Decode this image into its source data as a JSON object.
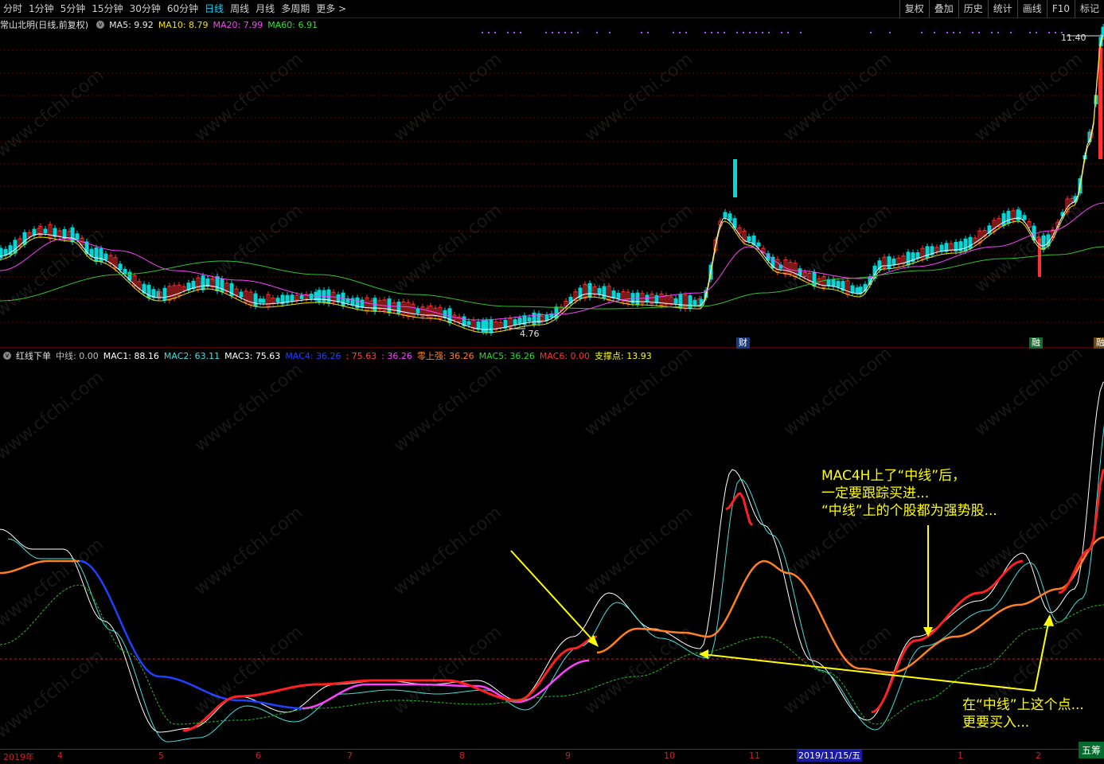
{
  "toolbar": {
    "tabs": [
      "分时",
      "1分钟",
      "5分钟",
      "15分钟",
      "30分钟",
      "60分钟",
      "日线",
      "周线",
      "月线",
      "多周期",
      "更多 >"
    ],
    "active_tab": "日线",
    "right": [
      "复权",
      "叠加",
      "历史",
      "统计",
      "画线",
      "F10",
      "标记"
    ]
  },
  "main_legend": {
    "title": "常山北明(日线,前复权)",
    "ma5": "MA5: 9.92",
    "ma10": "MA10: 8.79",
    "ma20": "MA20: 7.99",
    "ma60": "MA60: 6.91"
  },
  "indicator_legend": {
    "name": "红线下单",
    "items": [
      {
        "text": "中线: 0.00",
        "color": "#bfbfbf"
      },
      {
        "text": "MAC1: 88.16",
        "color": "#ffffff"
      },
      {
        "text": "MAC2: 63.11",
        "color": "#40e0e0"
      },
      {
        "text": "MAC3: 75.63",
        "color": "#ffffff"
      },
      {
        "text": "MAC4: 36.26",
        "color": "#2040ff"
      },
      {
        "text": ": 75.63",
        "color": "#ff4040"
      },
      {
        "text": ": 36.26",
        "color": "#ff40ff"
      },
      {
        "text": "零上强: 36.26",
        "color": "#ff8020"
      },
      {
        "text": "MAC5: 36.26",
        "color": "#20e020"
      },
      {
        "text": "MAC6: 0.00",
        "color": "#ff3030"
      },
      {
        "text": "支撑点: 13.93",
        "color": "#ffff00"
      }
    ]
  },
  "price_labels": {
    "high": "11.40",
    "low": "4.76"
  },
  "event_tags": [
    "财",
    "融",
    "融"
  ],
  "annotations": {
    "top": [
      "MAC4H上了“中线”后，",
      "一定要跟踪买进...",
      "“中线”上的个股都为强势股..."
    ],
    "bottom": [
      "在“中线”上这个点...",
      "更要买入..."
    ]
  },
  "watermark": "www.cfchi.com",
  "xaxis": {
    "labels": [
      "2019年",
      "4",
      "5",
      "6",
      "7",
      "8",
      "9",
      "10",
      "11",
      "2019/11/15/五",
      "1",
      "2"
    ],
    "current_date": "2019/11/15/五"
  },
  "wudang": "五筹"
}
